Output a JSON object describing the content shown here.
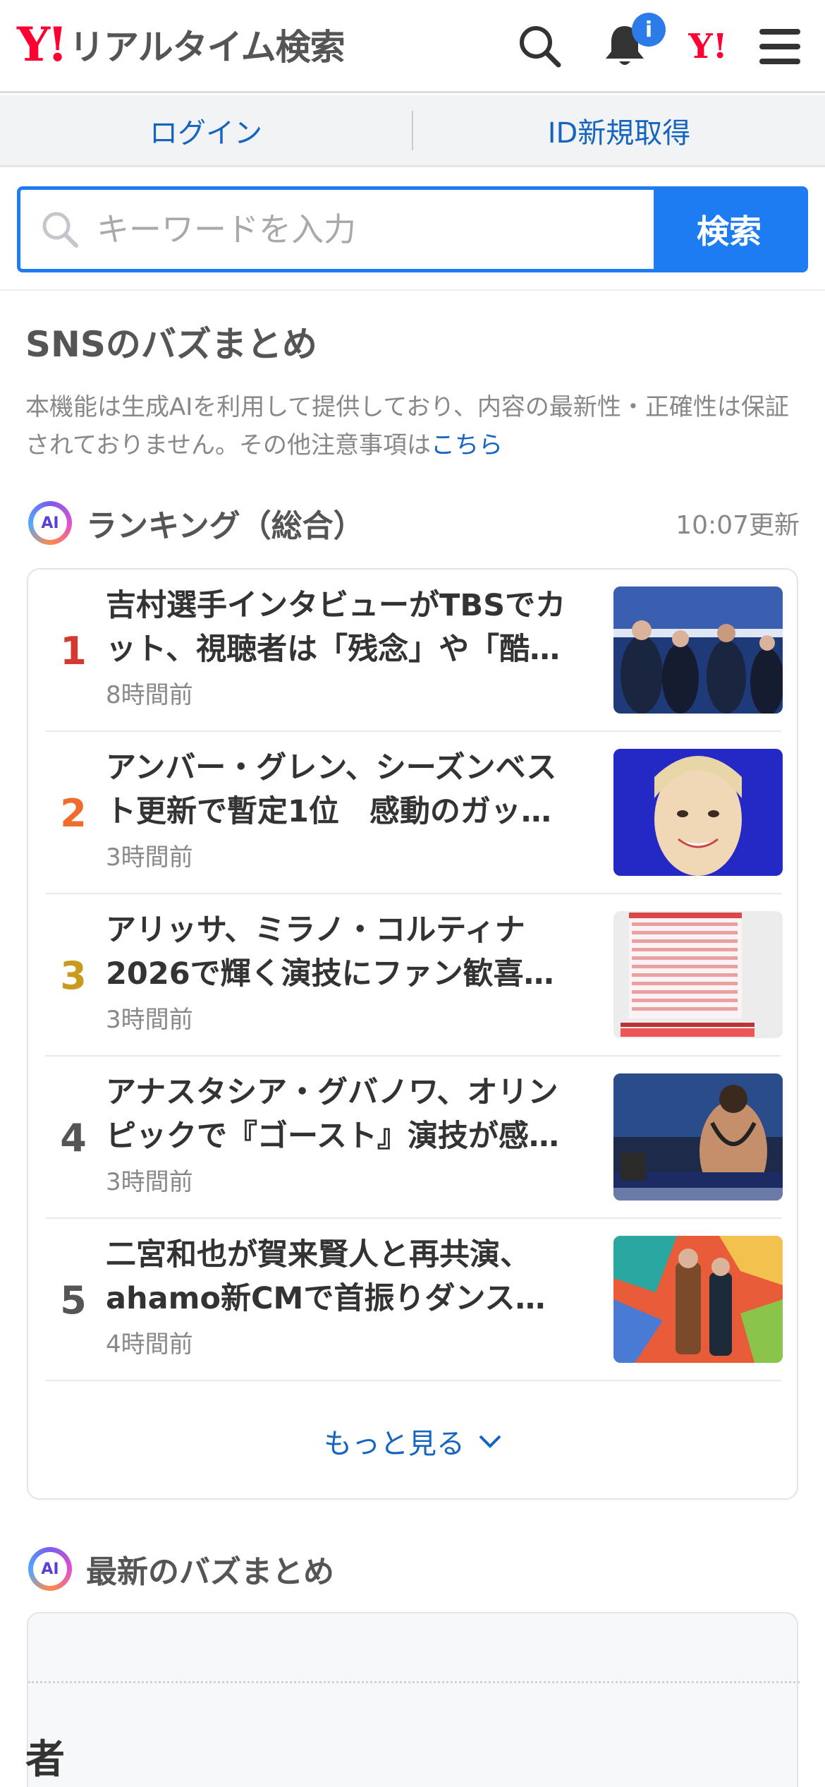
{
  "header": {
    "logo_mark": "Y!",
    "logo_text": "リアルタイム検索",
    "notification_badge": "i",
    "yj_mark": "Y!",
    "icons": [
      "search-icon",
      "bell-icon",
      "yahoo-japan-icon",
      "menu-icon"
    ]
  },
  "login_bar": {
    "login": "ログイン",
    "register": "ID新規取得"
  },
  "search": {
    "placeholder": "キーワードを入力",
    "button": "検索"
  },
  "section": {
    "title": "SNSのバズまとめ",
    "notice": "本機能は生成AIを利用して提供しており、内容の最新性・正確性は保証されておりません。その他注意事項は",
    "notice_link": "こちら"
  },
  "ranking": {
    "badge": "AI",
    "title": "ランキング（総合）",
    "updated": "10:07更新",
    "items": [
      {
        "rank": "1",
        "title": "吉村選手インタビューがTBSでカット、視聴者は「残念」や「酷…",
        "time": "8時間前",
        "rank_color": "#d43a2f"
      },
      {
        "rank": "2",
        "title": "アンバー・グレン、シーズンベスト更新で暫定1位　感動のガッ…",
        "time": "3時間前",
        "rank_color": "#ef6c2d"
      },
      {
        "rank": "3",
        "title": "アリッサ、ミラノ・コルティナ2026で輝く演技にファン歓喜…",
        "time": "3時間前",
        "rank_color": "#c99a1e"
      },
      {
        "rank": "4",
        "title": "アナスタシア・グバノワ、オリンピックで『ゴースト』演技が感…",
        "time": "3時間前",
        "rank_color": "#555555"
      },
      {
        "rank": "5",
        "title": "二宮和也が賀来賢人と再共演、ahamo新CMで首振りダンス…",
        "time": "4時間前",
        "rank_color": "#555555"
      }
    ],
    "more": "もっと見る"
  },
  "latest": {
    "badge": "AI",
    "title": "最新のバズまとめ",
    "first_char": "者"
  },
  "colors": {
    "accent": "#1e7cf2",
    "link": "#1565c0",
    "brand": "#ff0033"
  }
}
